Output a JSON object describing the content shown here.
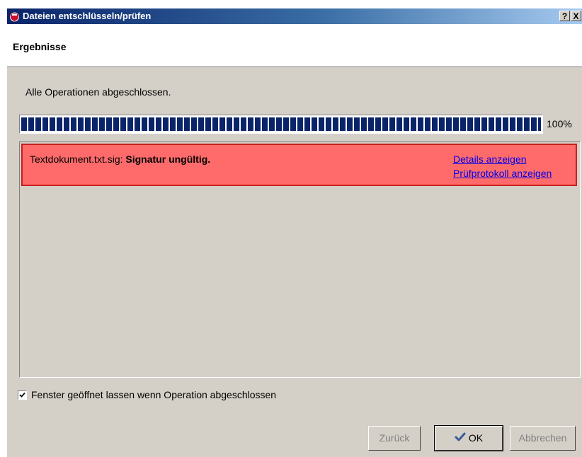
{
  "window": {
    "title": "Dateien entschlüsseln/prüfen",
    "help_label": "?",
    "close_label": "X"
  },
  "header": {
    "title": "Ergebnisse"
  },
  "status": {
    "message": "Alle Operationen abgeschlossen."
  },
  "progress": {
    "value_percent": 100,
    "label": "100%"
  },
  "results": [
    {
      "filename": "Textdokument.txt.sig:",
      "status": "Signatur ungültig.",
      "status_color": "#ff6b6b",
      "links": {
        "details": "Details anzeigen",
        "log": "Prüfprotokoll anzeigen"
      }
    }
  ],
  "options": {
    "keep_open_label": "Fenster geöffnet lassen wenn Operation abgeschlossen",
    "keep_open_checked": true
  },
  "buttons": {
    "back": "Zurück",
    "ok": "OK",
    "cancel": "Abbrechen"
  },
  "colors": {
    "accent": "#0a246a",
    "error_bg": "#ff6b6b",
    "link": "#0000ee"
  },
  "icons": {
    "app": "red-shield-icon",
    "ok": "checkmark-icon"
  }
}
